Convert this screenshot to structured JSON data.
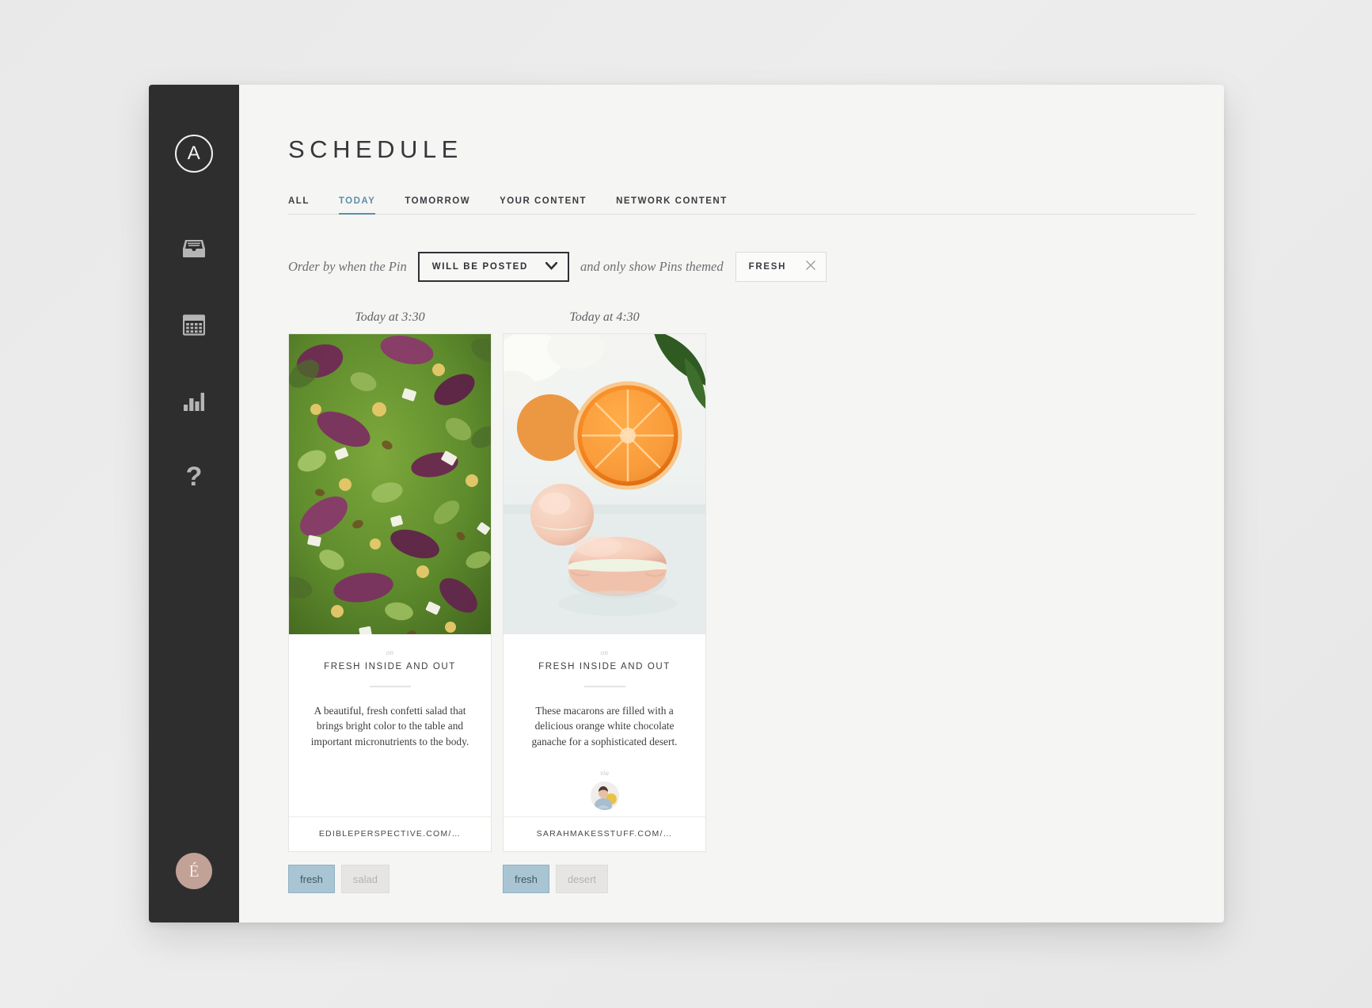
{
  "sidebar": {
    "logo_letter": "A",
    "items": [
      {
        "name": "inbox-icon",
        "label": "Inbox"
      },
      {
        "name": "calendar-icon",
        "label": "Calendar"
      },
      {
        "name": "analytics-icon",
        "label": "Analytics"
      },
      {
        "name": "help-icon",
        "label": "?"
      }
    ],
    "user_initial": "É"
  },
  "header": {
    "title": "SCHEDULE",
    "tabs": [
      {
        "label": "ALL",
        "active": false
      },
      {
        "label": "TODAY",
        "active": true
      },
      {
        "label": "TOMORROW",
        "active": false
      },
      {
        "label": "YOUR CONTENT",
        "active": false
      },
      {
        "label": "NETWORK CONTENT",
        "active": false
      }
    ],
    "accent_color": "#5c8fa8"
  },
  "filter": {
    "prefix_text": "Order by when the Pin",
    "select_value": "WILL BE POSTED",
    "select_icon": "chevron-down-icon",
    "middle_text": "and only show Pins themed",
    "theme_tag": "FRESH",
    "theme_clear_icon": "close-icon"
  },
  "cards": [
    {
      "time": "Today at 3:30",
      "on_label": "on",
      "board": "FRESH INSIDE AND OUT",
      "description": "A beautiful, fresh confetti salad that brings bright color to the table and important micronutrients to the body.",
      "via_label": null,
      "url": "EDIBLEPERSPECTIVE.COM/…",
      "tags": [
        {
          "label": "fresh",
          "active": true
        },
        {
          "label": "salad",
          "active": false
        }
      ]
    },
    {
      "time": "Today at 4:30",
      "on_label": "on",
      "board": "FRESH INSIDE AND OUT",
      "description": "These macarons are filled with a delicious orange white chocolate ganache for a sophisticated desert.",
      "via_label": "via",
      "url": "SARAHMAKESSTUFF.COM/…",
      "tags": [
        {
          "label": "fresh",
          "active": true
        },
        {
          "label": "desert",
          "active": false
        }
      ]
    }
  ]
}
